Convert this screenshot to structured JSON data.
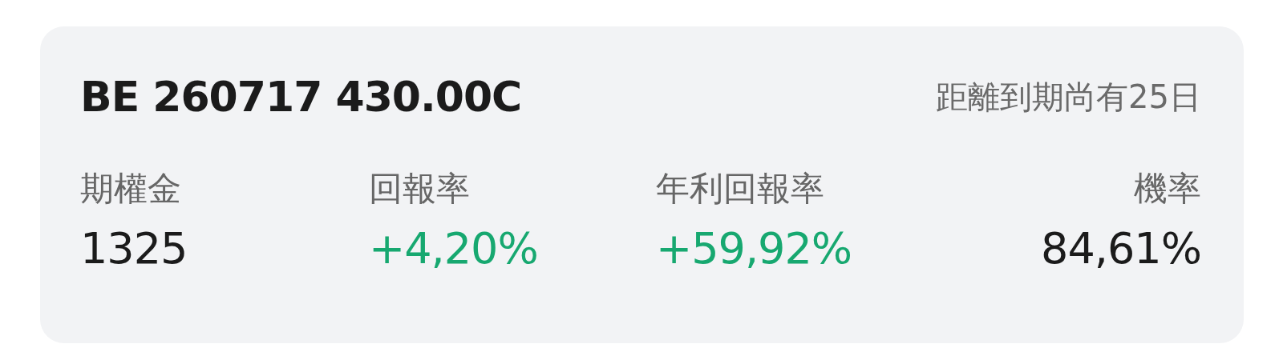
{
  "contract": {
    "title": "BE 260717 430.00C",
    "days_to_expiry": "距離到期尚有25日"
  },
  "metrics": [
    {
      "label": "期權金",
      "value": "1325",
      "kind": "neutral"
    },
    {
      "label": "回報率",
      "value": "+4,20%",
      "kind": "positive"
    },
    {
      "label": "年利回報率",
      "value": "+59,92%",
      "kind": "positive"
    },
    {
      "label": "機率",
      "value": "84,61%",
      "kind": "neutral"
    }
  ]
}
